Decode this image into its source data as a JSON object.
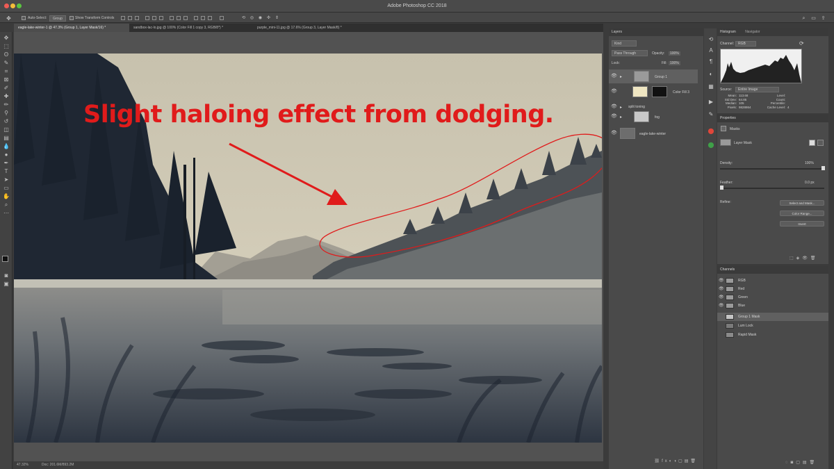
{
  "window": {
    "title": "Adobe Photoshop CC 2018"
  },
  "options_bar": {
    "auto_select_label": "Auto-Select:",
    "auto_select_value": "Group",
    "show_transform_label": "Show Transform Controls"
  },
  "tabs": [
    {
      "label": "eagle-lake-winter-1 @ 47.3% (Group 1, Layer Mask/16) *",
      "active": true
    },
    {
      "label": "sandbox-lac-lo.jpg @ 100% (Color Fill 1 copy 3, RGB/8*) *",
      "active": false
    },
    {
      "label": "purple_mini-11.jpg @ 17.6% (Group 3, Layer Mask/8) *",
      "active": false
    }
  ],
  "annotation": {
    "text": "Slight haloing effect from dodging.",
    "color": "#e01b1b"
  },
  "status": {
    "zoom": "47.32%",
    "doc": "Doc: 201.6M/893.2M"
  },
  "layers_panel": {
    "title": "Layers",
    "kind": "Kind",
    "blend": "Pass Through",
    "opacity_label": "Opacity:",
    "opacity": "100%",
    "lock_label": "Lock:",
    "fill_label": "Fill:",
    "fill": "100%",
    "layers": [
      {
        "name": "Group 1",
        "selected": true
      },
      {
        "name": "Color Fill 3",
        "selected": false
      },
      {
        "name": "split toning",
        "selected": false
      },
      {
        "name": "fog",
        "selected": false
      },
      {
        "name": "eagle-lake-winter",
        "selected": false
      }
    ]
  },
  "histogram_panel": {
    "tabs": [
      "Histogram",
      "Navigator"
    ],
    "channel_label": "Channel:",
    "channel": "RGB",
    "source_label": "Source:",
    "source": "Entire Image",
    "stats": [
      {
        "k": "Mean:",
        "v": "113.68",
        "k2": "Level:",
        "v2": ""
      },
      {
        "k": "Std Dev:",
        "v": "64.85",
        "k2": "Count:",
        "v2": ""
      },
      {
        "k": "Median:",
        "v": "105",
        "k2": "Percentile:",
        "v2": ""
      },
      {
        "k": "Pixels:",
        "v": "9828864",
        "k2": "Cache Level:",
        "v2": "4"
      }
    ]
  },
  "properties_panel": {
    "title": "Properties",
    "masks_label": "Masks",
    "mask_name": "Layer Mask",
    "density_label": "Density:",
    "density": "100%",
    "feather_label": "Feather:",
    "feather": "0.0 px",
    "refine_label": "Refine:",
    "buttons": [
      "Select and Mask...",
      "Color Range...",
      "Invert"
    ]
  },
  "channels_panel": {
    "title": "Channels",
    "channels": [
      {
        "name": "RGB",
        "visible": true,
        "selected": false
      },
      {
        "name": "Red",
        "visible": true,
        "selected": false
      },
      {
        "name": "Green",
        "visible": true,
        "selected": false
      },
      {
        "name": "Blue",
        "visible": true,
        "selected": false
      },
      {
        "name": "Group 1 Mask",
        "visible": false,
        "selected": true
      },
      {
        "name": "Lum Lock",
        "visible": false,
        "selected": false
      },
      {
        "name": "Rapid Mask",
        "visible": false,
        "selected": false
      }
    ]
  },
  "colors": {
    "annotation_red": "#e01b1b",
    "panel_bg": "#4a4a4a",
    "canvas_bg": "#525252"
  }
}
